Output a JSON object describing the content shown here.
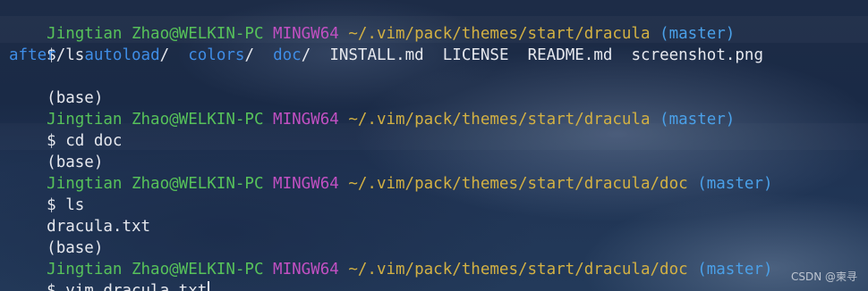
{
  "prompt": {
    "user_host": "Jingtian Zhao@WELKIN-PC",
    "system": "MINGW64",
    "branch": "(master)"
  },
  "lines": {
    "l1": {
      "path": "~/.vim/pack/themes/start/dracula"
    },
    "l2": {
      "cmd": "$ ls"
    },
    "l3": {
      "dirs": [
        "after",
        "autoload",
        "colors",
        "doc"
      ],
      "sep": "/",
      "files": [
        "INSTALL.md",
        "LICENSE",
        "README.md",
        "screenshot.png"
      ]
    },
    "l4": {
      "text": "(base)"
    },
    "l5": {
      "path": "~/.vim/pack/themes/start/dracula"
    },
    "l6": {
      "cmd": "$ cd doc"
    },
    "l7": {
      "text": "(base)"
    },
    "l8": {
      "path": "~/.vim/pack/themes/start/dracula/doc"
    },
    "l9": {
      "cmd": "$ ls"
    },
    "l10": {
      "text": "dracula.txt"
    },
    "l11": {
      "text": "(base)"
    },
    "l12": {
      "path": "~/.vim/pack/themes/start/dracula/doc"
    },
    "l13": {
      "cmd": "$ vim dracula.txt"
    }
  },
  "watermark": "CSDN @柬寻",
  "colors": {
    "user_host": "#57c25a",
    "system": "#c150c2",
    "path": "#d3b143",
    "branch": "#4aa0e8",
    "directory": "#3f8de6",
    "text": "#e6e8ee"
  }
}
